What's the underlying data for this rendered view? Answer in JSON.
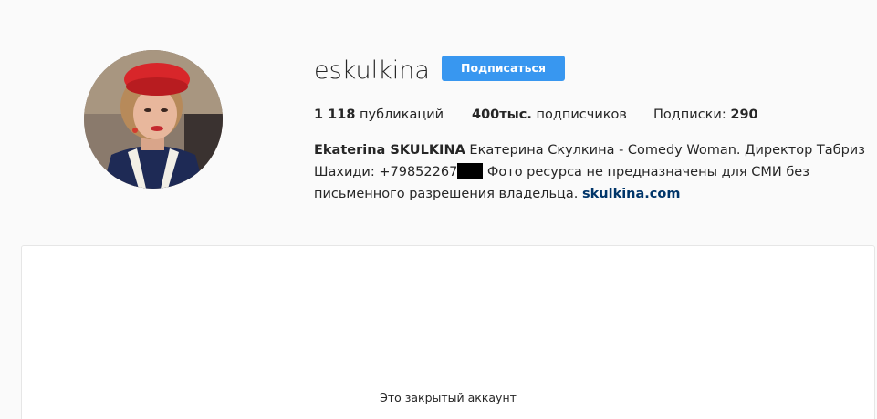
{
  "profile": {
    "username": "eskulkina",
    "follow_label": "Подписаться",
    "stats": {
      "posts_count": "1 118",
      "posts_label": " публикаций",
      "followers_count": "400тыс.",
      "followers_label": " подписчиков",
      "following_label": "Подписки: ",
      "following_count": "290"
    },
    "bio": {
      "name": "Ekaterina SKULKINA",
      "line1_rest": " Екатерина Скулкина - Comedy Woman. Директор Табриз",
      "line2_pre": "Шахиди: +79852267",
      "line2_post": " Фото ресурса не предназначены для СМИ без",
      "line3": "письменного разрешения владельца. ",
      "link": "skulkina.com"
    }
  },
  "private": {
    "message": "Это закрытый аккаунт"
  },
  "colors": {
    "accent": "#3897f0",
    "link": "#003569",
    "background": "#fafafa"
  }
}
